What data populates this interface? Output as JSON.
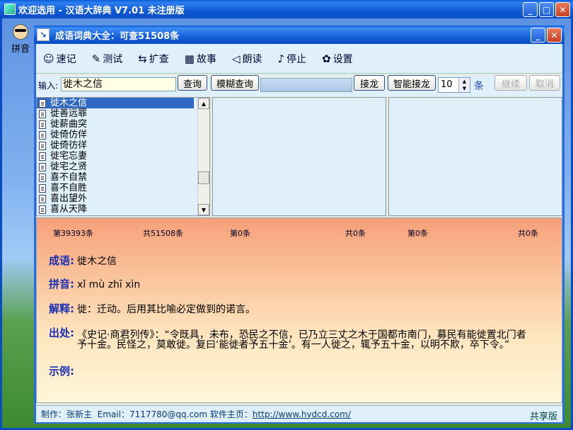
{
  "outer": {
    "title": "欢迎选用 - 汉语大辞典 V7.01 未注册版"
  },
  "left_tool": {
    "label": "拼音"
  },
  "inner": {
    "title": "成语词典大全：可查51508条",
    "icon": "↘"
  },
  "toolbar": [
    {
      "label": "速记",
      "icon": "☺"
    },
    {
      "label": "测试",
      "icon": "✎"
    },
    {
      "label": "扩查",
      "icon": "⇆"
    },
    {
      "label": "故事",
      "icon": "▦"
    },
    {
      "label": "朗读",
      "icon": "◁"
    },
    {
      "label": "停止",
      "icon": "♪"
    },
    {
      "label": "设置",
      "icon": "✿"
    }
  ],
  "input_row": {
    "label": "输入:",
    "value": "徙木之信",
    "query_btn": "查询",
    "fuzzy_btn": "模糊查询",
    "chain_btn": "接龙",
    "smart_chain_btn": "智能接龙",
    "count_value": "10",
    "count_unit": "条",
    "continue_btn": "继续",
    "cancel_btn": "取消"
  },
  "list1": [
    "徙木之信",
    "徙善远罪",
    "徙薪曲突",
    "徙倚仿佯",
    "徙倚彷徉",
    "徙宅忘妻",
    "徙宅之贤",
    "喜不自禁",
    "喜不自胜",
    "喜出望外",
    "喜从天降"
  ],
  "counts": {
    "c1": "第39393条",
    "c2": "共51508条",
    "c3": "第0条",
    "c4": "共0条",
    "c5": "第0条",
    "c6": "共0条"
  },
  "detail": {
    "idiom_label": "成语:",
    "idiom": "徙木之信",
    "pinyin_label": "拼音:",
    "pinyin": "xǐ mù zhī xìn",
    "meaning_label": "解释:",
    "meaning": "徙：迁动。后用其比喻必定做到的诺言。",
    "source_label": "出处:",
    "source": "《史记·商君列传》：“令既具，未布，恐民之不信，已乃立三丈之木于国都市南门，募民有能徙置北门者予十金。民怪之，莫敢徙。复曰‘能徙者予五十金’。有一人徙之，辄予五十金，以明不欺，卒下令。”",
    "example_label": "示例:",
    "example": ""
  },
  "status": {
    "author": "制作：张新主",
    "email": "Email：7117780@qq.com",
    "homepage_label": "软件主页：",
    "homepage": "http://www.hydcd.com/",
    "share": "共享版"
  }
}
